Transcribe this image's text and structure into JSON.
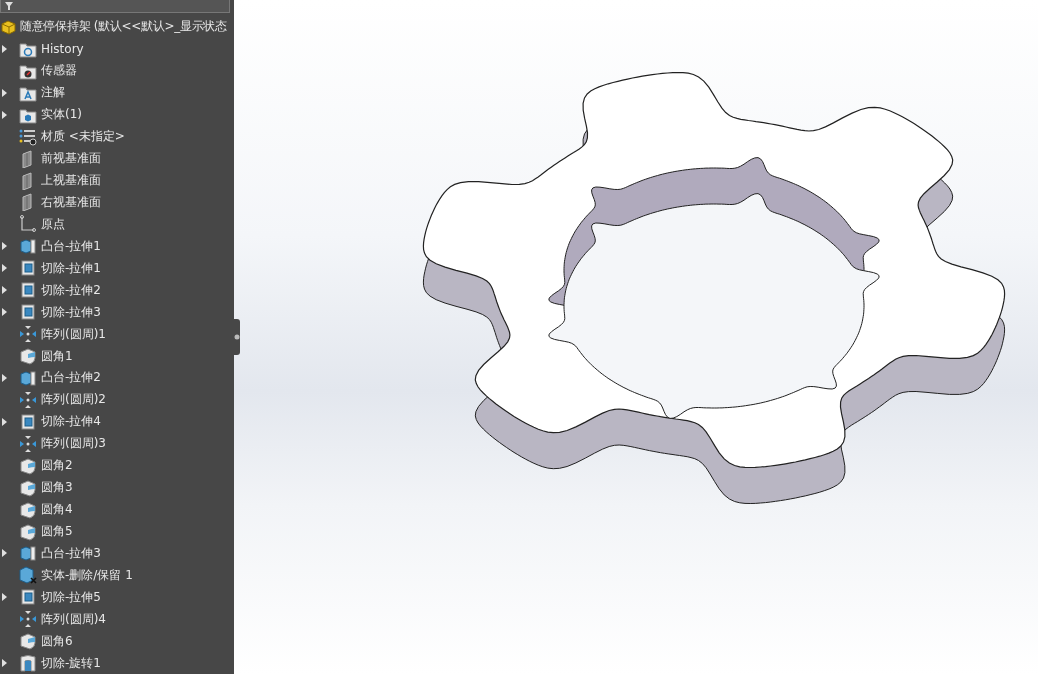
{
  "tree": {
    "root": {
      "label": "随意停保持架  (默认<<默认>_显示状态"
    },
    "items": [
      {
        "label": "History",
        "kind": "history",
        "expandable": true
      },
      {
        "label": "传感器",
        "kind": "sensor",
        "expandable": false
      },
      {
        "label": "注解",
        "kind": "annotation",
        "expandable": true
      },
      {
        "label": "实体(1)",
        "kind": "solid-folder",
        "expandable": true
      },
      {
        "label": "材质 <未指定>",
        "kind": "material",
        "expandable": false
      },
      {
        "label": "前视基准面",
        "kind": "plane",
        "expandable": false
      },
      {
        "label": "上视基准面",
        "kind": "plane",
        "expandable": false
      },
      {
        "label": "右视基准面",
        "kind": "plane",
        "expandable": false
      },
      {
        "label": "原点",
        "kind": "origin",
        "expandable": false
      },
      {
        "label": "凸台-拉伸1",
        "kind": "boss",
        "expandable": true
      },
      {
        "label": "切除-拉伸1",
        "kind": "cut",
        "expandable": true
      },
      {
        "label": "切除-拉伸2",
        "kind": "cut",
        "expandable": true
      },
      {
        "label": "切除-拉伸3",
        "kind": "cut",
        "expandable": true
      },
      {
        "label": "阵列(圆周)1",
        "kind": "pattern",
        "expandable": false
      },
      {
        "label": "圆角1",
        "kind": "fillet",
        "expandable": false
      },
      {
        "label": "凸台-拉伸2",
        "kind": "boss",
        "expandable": true
      },
      {
        "label": "阵列(圆周)2",
        "kind": "pattern",
        "expandable": false
      },
      {
        "label": "切除-拉伸4",
        "kind": "cut",
        "expandable": true
      },
      {
        "label": "阵列(圆周)3",
        "kind": "pattern",
        "expandable": false
      },
      {
        "label": "圆角2",
        "kind": "fillet",
        "expandable": false
      },
      {
        "label": "圆角3",
        "kind": "fillet",
        "expandable": false
      },
      {
        "label": "圆角4",
        "kind": "fillet",
        "expandable": false
      },
      {
        "label": "圆角5",
        "kind": "fillet",
        "expandable": false
      },
      {
        "label": "凸台-拉伸3",
        "kind": "boss",
        "expandable": true
      },
      {
        "label": "实体-删除/保留 1",
        "kind": "delete-body",
        "expandable": false
      },
      {
        "label": "切除-拉伸5",
        "kind": "cut",
        "expandable": true
      },
      {
        "label": "阵列(圆周)4",
        "kind": "pattern",
        "expandable": false
      },
      {
        "label": "圆角6",
        "kind": "fillet",
        "expandable": false
      },
      {
        "label": "切除-旋转1",
        "kind": "revolve-cut",
        "expandable": true
      }
    ]
  }
}
